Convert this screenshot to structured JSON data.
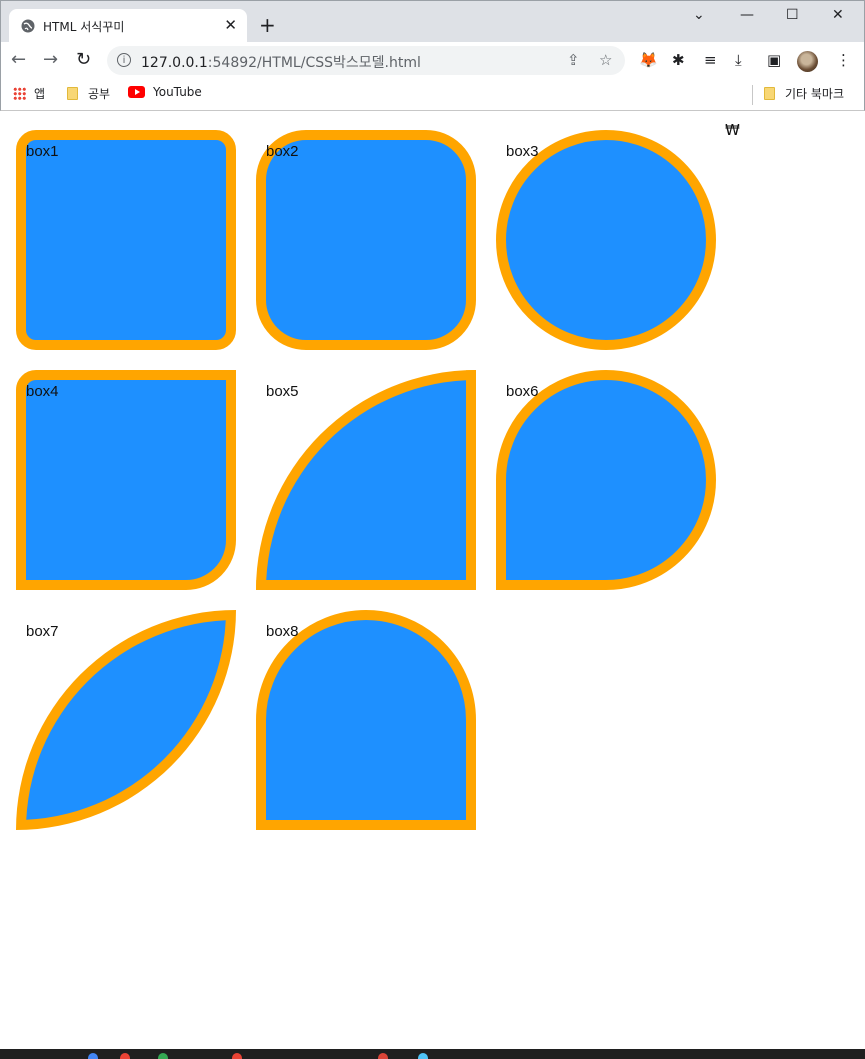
{
  "tab": {
    "title": "HTML 서식꾸미",
    "close": "✕",
    "globe_icon": "globe-icon"
  },
  "newtab": "+",
  "window_controls": {
    "chevron": "⌄",
    "minimize": "—",
    "maximize": "☐",
    "close": "✕"
  },
  "toolbar": {
    "back": "←",
    "forward": "→",
    "reload": "↻",
    "url_host": "127.0.0.1",
    "url_rest": ":54892/HTML/CSS박스모델.html",
    "share": "⇪",
    "star": "☆",
    "extensions": [
      "🦊",
      "✱",
      "≡",
      "⤓",
      "▣",
      "⋮"
    ]
  },
  "bookmarks": {
    "apps": "앱",
    "study": "공부",
    "youtube": "YouTube",
    "other": "기타 북마크"
  },
  "page": {
    "currency": "₩",
    "boxes": [
      {
        "label": "box1"
      },
      {
        "label": "box2"
      },
      {
        "label": "box3"
      },
      {
        "label": "box4"
      },
      {
        "label": "box5"
      },
      {
        "label": "box6"
      },
      {
        "label": "box7"
      },
      {
        "label": "box8"
      }
    ]
  },
  "colors": {
    "fill": "#1e90ff",
    "border": "#ffa500"
  }
}
